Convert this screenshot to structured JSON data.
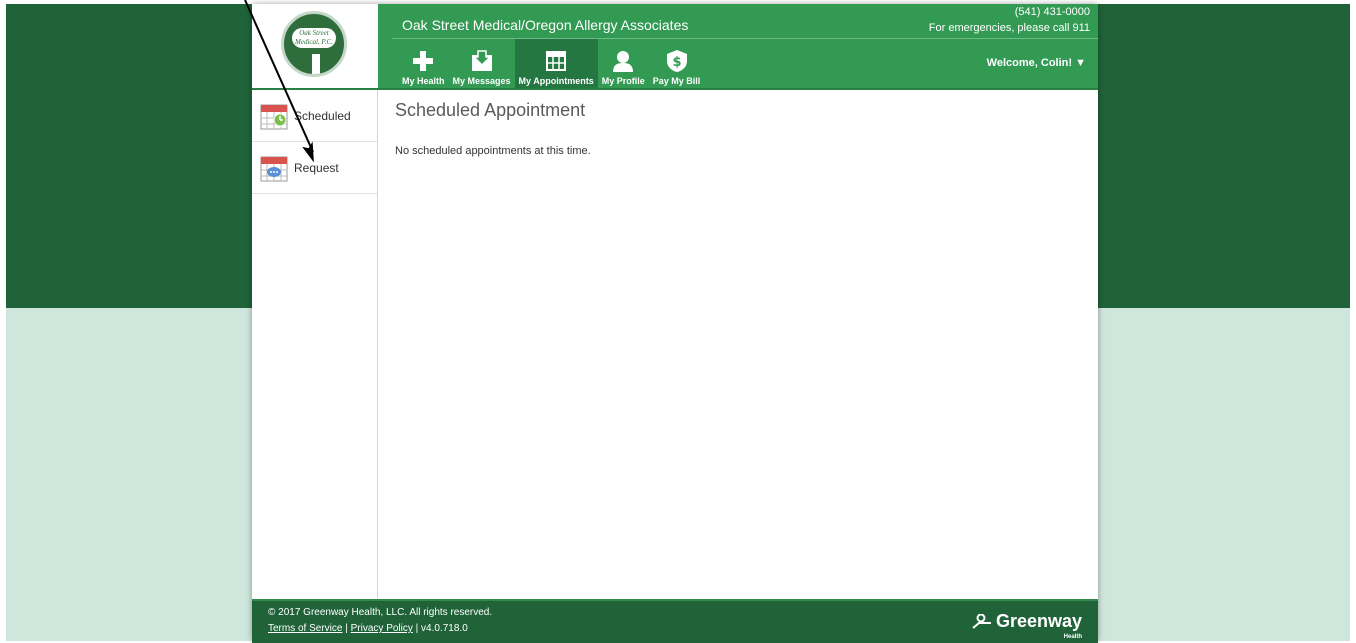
{
  "header": {
    "logo_text": "Oak Street Medical, P.C.",
    "practice_name": "Oak Street Medical/Oregon Allergy Associates",
    "phone": "(541) 431-0000",
    "emergency": "For emergencies, please call 911",
    "welcome": "Welcome, Colin!",
    "welcome_arrow": "▼"
  },
  "nav": {
    "items": [
      {
        "label": "My Health",
        "icon": "plus-icon"
      },
      {
        "label": "My Messages",
        "icon": "inbox-icon"
      },
      {
        "label": "My Appointments",
        "icon": "calendar-grid-icon",
        "active": true
      },
      {
        "label": "My Profile",
        "icon": "person-icon"
      },
      {
        "label": "Pay My Bill",
        "icon": "dollar-shield-icon"
      }
    ]
  },
  "sidebar": {
    "items": [
      {
        "label": "Scheduled",
        "icon": "calendar-clock-icon"
      },
      {
        "label": "Request",
        "icon": "calendar-chat-icon"
      }
    ]
  },
  "main": {
    "title": "Scheduled Appointment",
    "message": "No scheduled appointments at this time."
  },
  "footer": {
    "copyright": "© 2017 Greenway Health, LLC. All rights reserved.",
    "terms": "Terms of Service",
    "separator": "|",
    "privacy": "Privacy Policy",
    "version": "| v4.0.718.0",
    "brand": "Greenway",
    "brand_sub": "Health"
  },
  "colors": {
    "header_green": "#329a53",
    "dark_green": "#206339",
    "light_green_bg": "#cfe6dc",
    "calendar_red": "#d9534f"
  }
}
